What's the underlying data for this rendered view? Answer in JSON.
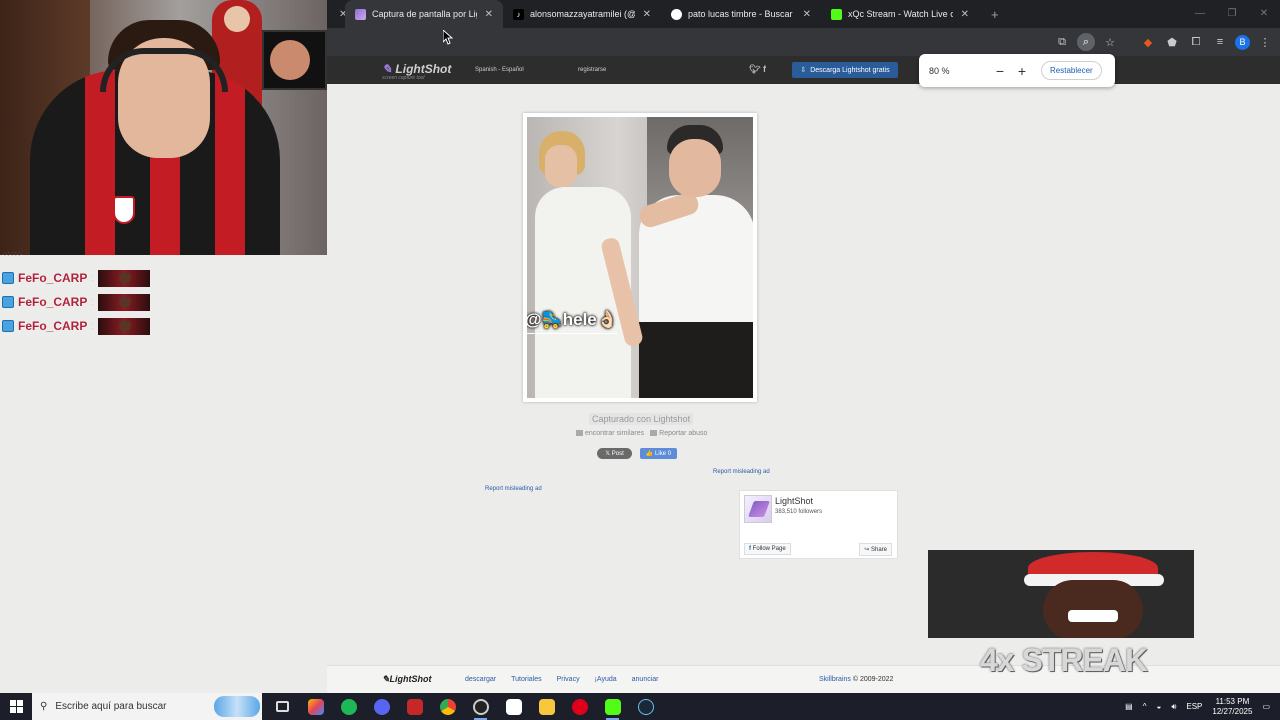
{
  "browser": {
    "tabs": [
      {
        "title": "Captura de pantalla por Lightshot",
        "color": "#8b6fd0",
        "active": true
      },
      {
        "title": "alonsomazzayatramilei (@alonsomazzayatramilei)",
        "color": "#ffffff",
        "active": false
      },
      {
        "title": "pato lucas timbre - Buscar con Google",
        "color": "#ffffff",
        "active": false
      },
      {
        "title": "xQc Stream - Watch Live on Kick",
        "color": "#53fc18",
        "active": false
      }
    ],
    "new_tab": "+",
    "zoom_popup": {
      "value": "80 %",
      "minus": "−",
      "plus": "+",
      "reset": "Restablecer"
    },
    "profile_initial": "B"
  },
  "lightshot": {
    "logo": "LightShot",
    "logo_sub": "screen capture tool",
    "language": "Spanish - Español",
    "register": "registrarse",
    "download_button": "Descarga Lightshot gratis",
    "image_stamp": "@🛼hele👌🏻",
    "captured_label": "Capturado con Lightshot",
    "find_similar": "encontrar similares",
    "report_abuse": "Reportar abuso",
    "post_button": "𝕏 Post",
    "like_button": "👍 Like 0",
    "ad_report_1": "Report misleading ad",
    "ad_report_2": "Report misleading ad",
    "fb": {
      "name": "LightShot",
      "followers": "383,510 followers",
      "follow": "Follow Page",
      "share": "Share"
    },
    "footer": {
      "logo": "LightShot",
      "links": [
        "descargar",
        "Tutoriales",
        "Privacy",
        "¡Ayuda",
        "anunciar"
      ],
      "company": "Skillbrains",
      "copyright": " © 2009-2022"
    }
  },
  "stream": {
    "small_label": "·:·:·:·:·:·",
    "chat": [
      {
        "user": "FeFo_CARP",
        "sep": ":"
      },
      {
        "user": "FeFo_CARP",
        "sep": ":"
      },
      {
        "user": "FeFo_CARP",
        "sep": ":"
      }
    ],
    "streak": "4x STREAK"
  },
  "taskbar": {
    "search_placeholder": "Escribe aquí para buscar",
    "language": "ESP",
    "time": "11:53 PM",
    "date": "12/27/2025"
  }
}
